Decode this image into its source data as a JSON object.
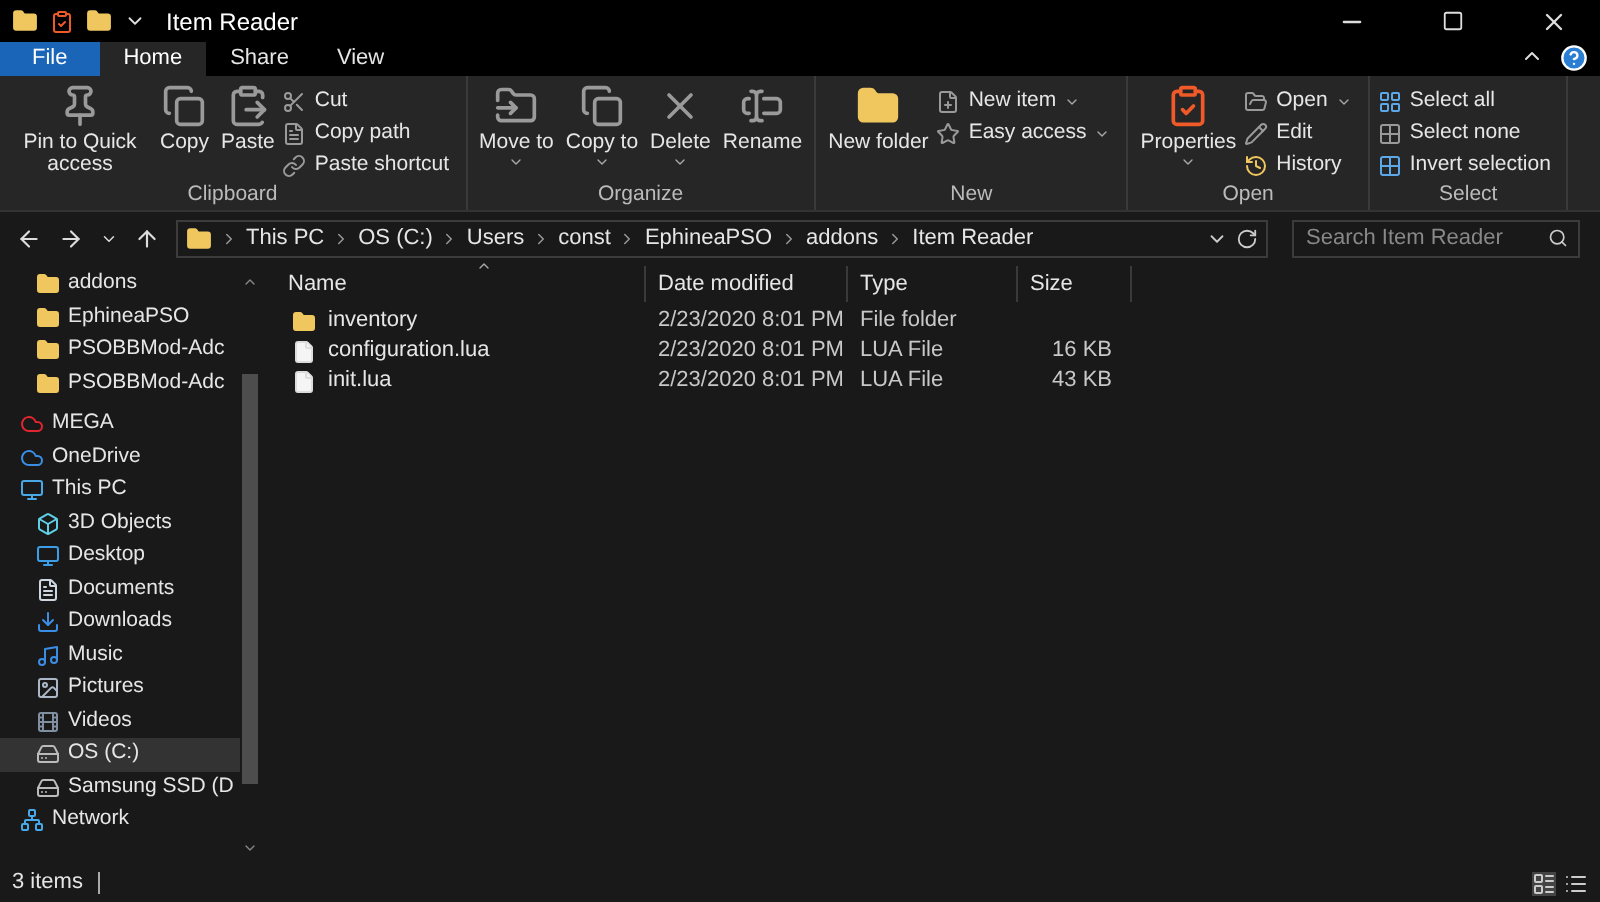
{
  "window": {
    "title": "Item Reader"
  },
  "tabs": [
    {
      "label": "File",
      "kind": "file",
      "selected": false
    },
    {
      "label": "Home",
      "kind": "tab",
      "selected": true
    },
    {
      "label": "Share",
      "kind": "tab",
      "selected": false
    },
    {
      "label": "View",
      "kind": "tab",
      "selected": false
    }
  ],
  "ribbon": {
    "groups": [
      {
        "label": "Clipboard",
        "large": [
          {
            "label": "Pin to Quick access",
            "kind": "pin"
          },
          {
            "label": "Copy",
            "kind": "copy"
          },
          {
            "label": "Paste",
            "kind": "paste"
          }
        ],
        "small": [
          {
            "label": "Cut",
            "kind": "cut"
          },
          {
            "label": "Copy path",
            "kind": "copypath"
          },
          {
            "label": "Paste shortcut",
            "kind": "shortcut"
          }
        ]
      },
      {
        "label": "Organize",
        "large": [
          {
            "label": "Move to",
            "kind": "move",
            "dropdown": true
          },
          {
            "label": "Copy to",
            "kind": "copy",
            "dropdown": true
          },
          {
            "label": "Delete",
            "kind": "delete",
            "dropdown": true
          },
          {
            "label": "Rename",
            "kind": "rename",
            "dropdown": false
          }
        ]
      },
      {
        "label": "New",
        "large": [
          {
            "label": "New folder",
            "kind": "folder",
            "dropdown": false
          }
        ],
        "small": [
          {
            "label": "New item",
            "kind": "newitem",
            "dropdown": true
          },
          {
            "label": "Easy access",
            "kind": "easy",
            "dropdown": true
          }
        ]
      },
      {
        "label": "Open",
        "large": [
          {
            "label": "Properties",
            "kind": "properties",
            "dropdown": true
          }
        ],
        "small": [
          {
            "label": "Open",
            "kind": "open",
            "dropdown": true
          },
          {
            "label": "Edit",
            "kind": "edit",
            "dropdown": false
          },
          {
            "label": "History",
            "kind": "history",
            "dropdown": false
          }
        ]
      },
      {
        "label": "Select",
        "small": [
          {
            "label": "Select all",
            "kind": "selectall"
          },
          {
            "label": "Select none",
            "kind": "selectnone"
          },
          {
            "label": "Invert selection",
            "kind": "invert"
          }
        ]
      }
    ]
  },
  "address_bar": {
    "path": [
      "This PC",
      "OS (C:)",
      "Users",
      "const",
      "EphineaPSO",
      "addons",
      "Item Reader"
    ]
  },
  "search": {
    "placeholder": "Search Item Reader"
  },
  "nav_pane": {
    "quick_access": [
      {
        "label": "addons",
        "kind": "folder",
        "selected": false
      },
      {
        "label": "EphineaPSO",
        "kind": "folder",
        "selected": false
      },
      {
        "label": "PSOBBMod-Adc",
        "kind": "folder",
        "selected": false
      },
      {
        "label": "PSOBBMod-Adc",
        "kind": "folder",
        "selected": false
      }
    ],
    "items": [
      {
        "label": "MEGA",
        "kind": "mega",
        "selected": false
      },
      {
        "label": "OneDrive",
        "kind": "onedrive",
        "selected": false
      },
      {
        "label": "This PC",
        "kind": "pc",
        "selected": false,
        "children": [
          {
            "label": "3D Objects",
            "kind": "objects",
            "selected": false
          },
          {
            "label": "Desktop",
            "kind": "desktop",
            "selected": false
          },
          {
            "label": "Documents",
            "kind": "documents",
            "selected": false
          },
          {
            "label": "Downloads",
            "kind": "downloads",
            "selected": false
          },
          {
            "label": "Music",
            "kind": "music",
            "selected": false
          },
          {
            "label": "Pictures",
            "kind": "pictures",
            "selected": false
          },
          {
            "label": "Videos",
            "kind": "videos",
            "selected": false
          },
          {
            "label": "OS (C:)",
            "kind": "drive",
            "selected": true
          },
          {
            "label": "Samsung SSD (D",
            "kind": "drive2",
            "selected": false
          }
        ]
      },
      {
        "label": "Network",
        "kind": "network",
        "selected": false
      }
    ]
  },
  "table": {
    "columns": [
      "Name",
      "Date modified",
      "Type",
      "Size"
    ],
    "rows": [
      {
        "name": "inventory",
        "kind": "folder",
        "date": "2/23/2020 8:01 PM",
        "type": "File folder"
      },
      {
        "name": "configuration.lua",
        "kind": "file",
        "date": "2/23/2020 8:01 PM",
        "type": "LUA File",
        "size": "16 KB"
      },
      {
        "name": "init.lua",
        "kind": "file",
        "date": "2/23/2020 8:01 PM",
        "type": "LUA File",
        "size": "43 KB"
      }
    ]
  },
  "status_bar": {
    "text": "3 items"
  }
}
